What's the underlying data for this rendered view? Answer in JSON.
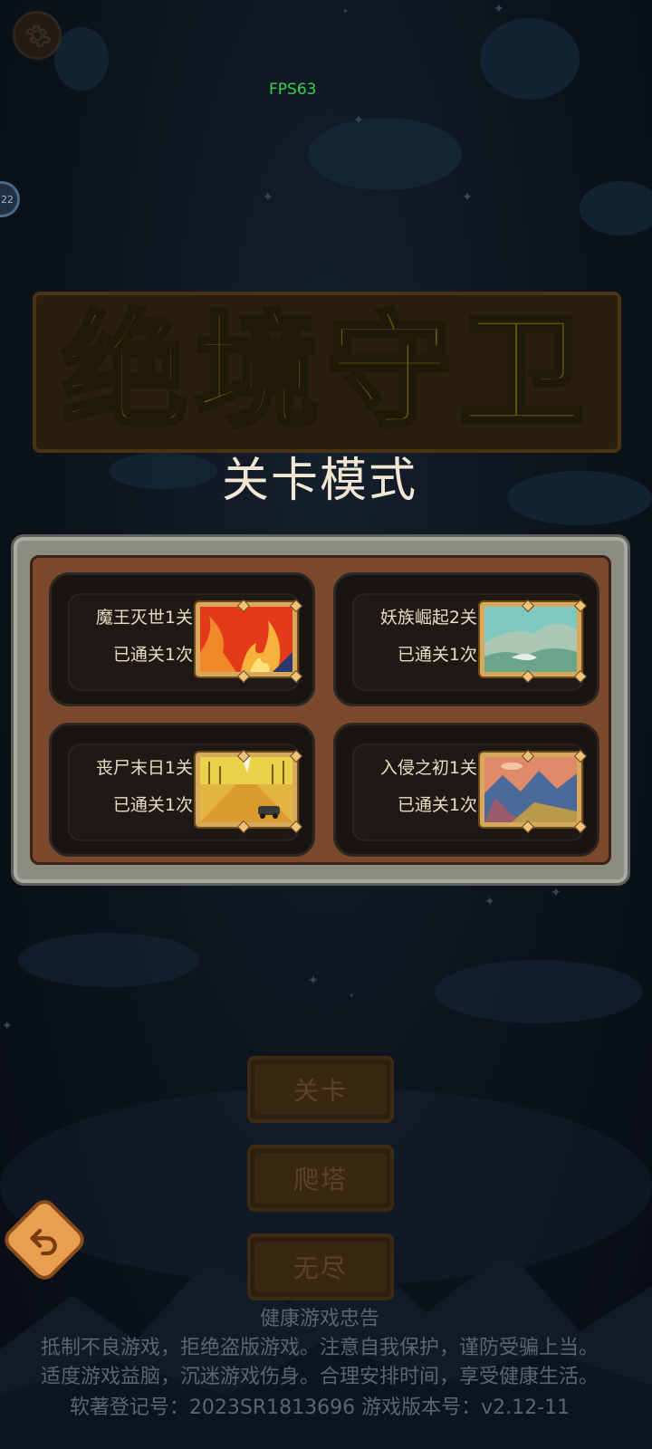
{
  "hud": {
    "fps": "FPS63",
    "side_badge": "22"
  },
  "logo": {
    "text": "绝境守卫"
  },
  "mode_title": "关卡模式",
  "levels": [
    {
      "name": "魔王灭世1关",
      "cleared": "已通关1次",
      "theme": "fire"
    },
    {
      "name": "妖族崛起2关",
      "cleared": "已通关1次",
      "theme": "valley"
    },
    {
      "name": "丧尸末日1关",
      "cleared": "已通关1次",
      "theme": "road"
    },
    {
      "name": "入侵之初1关",
      "cleared": "已通关1次",
      "theme": "mountains"
    }
  ],
  "menu": {
    "levels_label": "关卡",
    "tower_label": "爬塔",
    "endless_label": "无尽"
  },
  "footer": {
    "title": "健康游戏忠告",
    "line1": "抵制不良游戏，拒绝盗版游戏。注意自我保护，谨防受骗上当。",
    "line2": "适度游戏益脑，沉迷游戏伤身。合理安排时间，享受健康生活。",
    "line3": "软著登记号：2023SR1813696    游戏版本号：v2.12-11"
  },
  "colors": {
    "fps": "#36d14d",
    "panel_frame": "#8b8c84",
    "panel_wood": "#7b4a2d",
    "thumb_frame": "#d8a85c",
    "back_button": "#e8a050"
  }
}
